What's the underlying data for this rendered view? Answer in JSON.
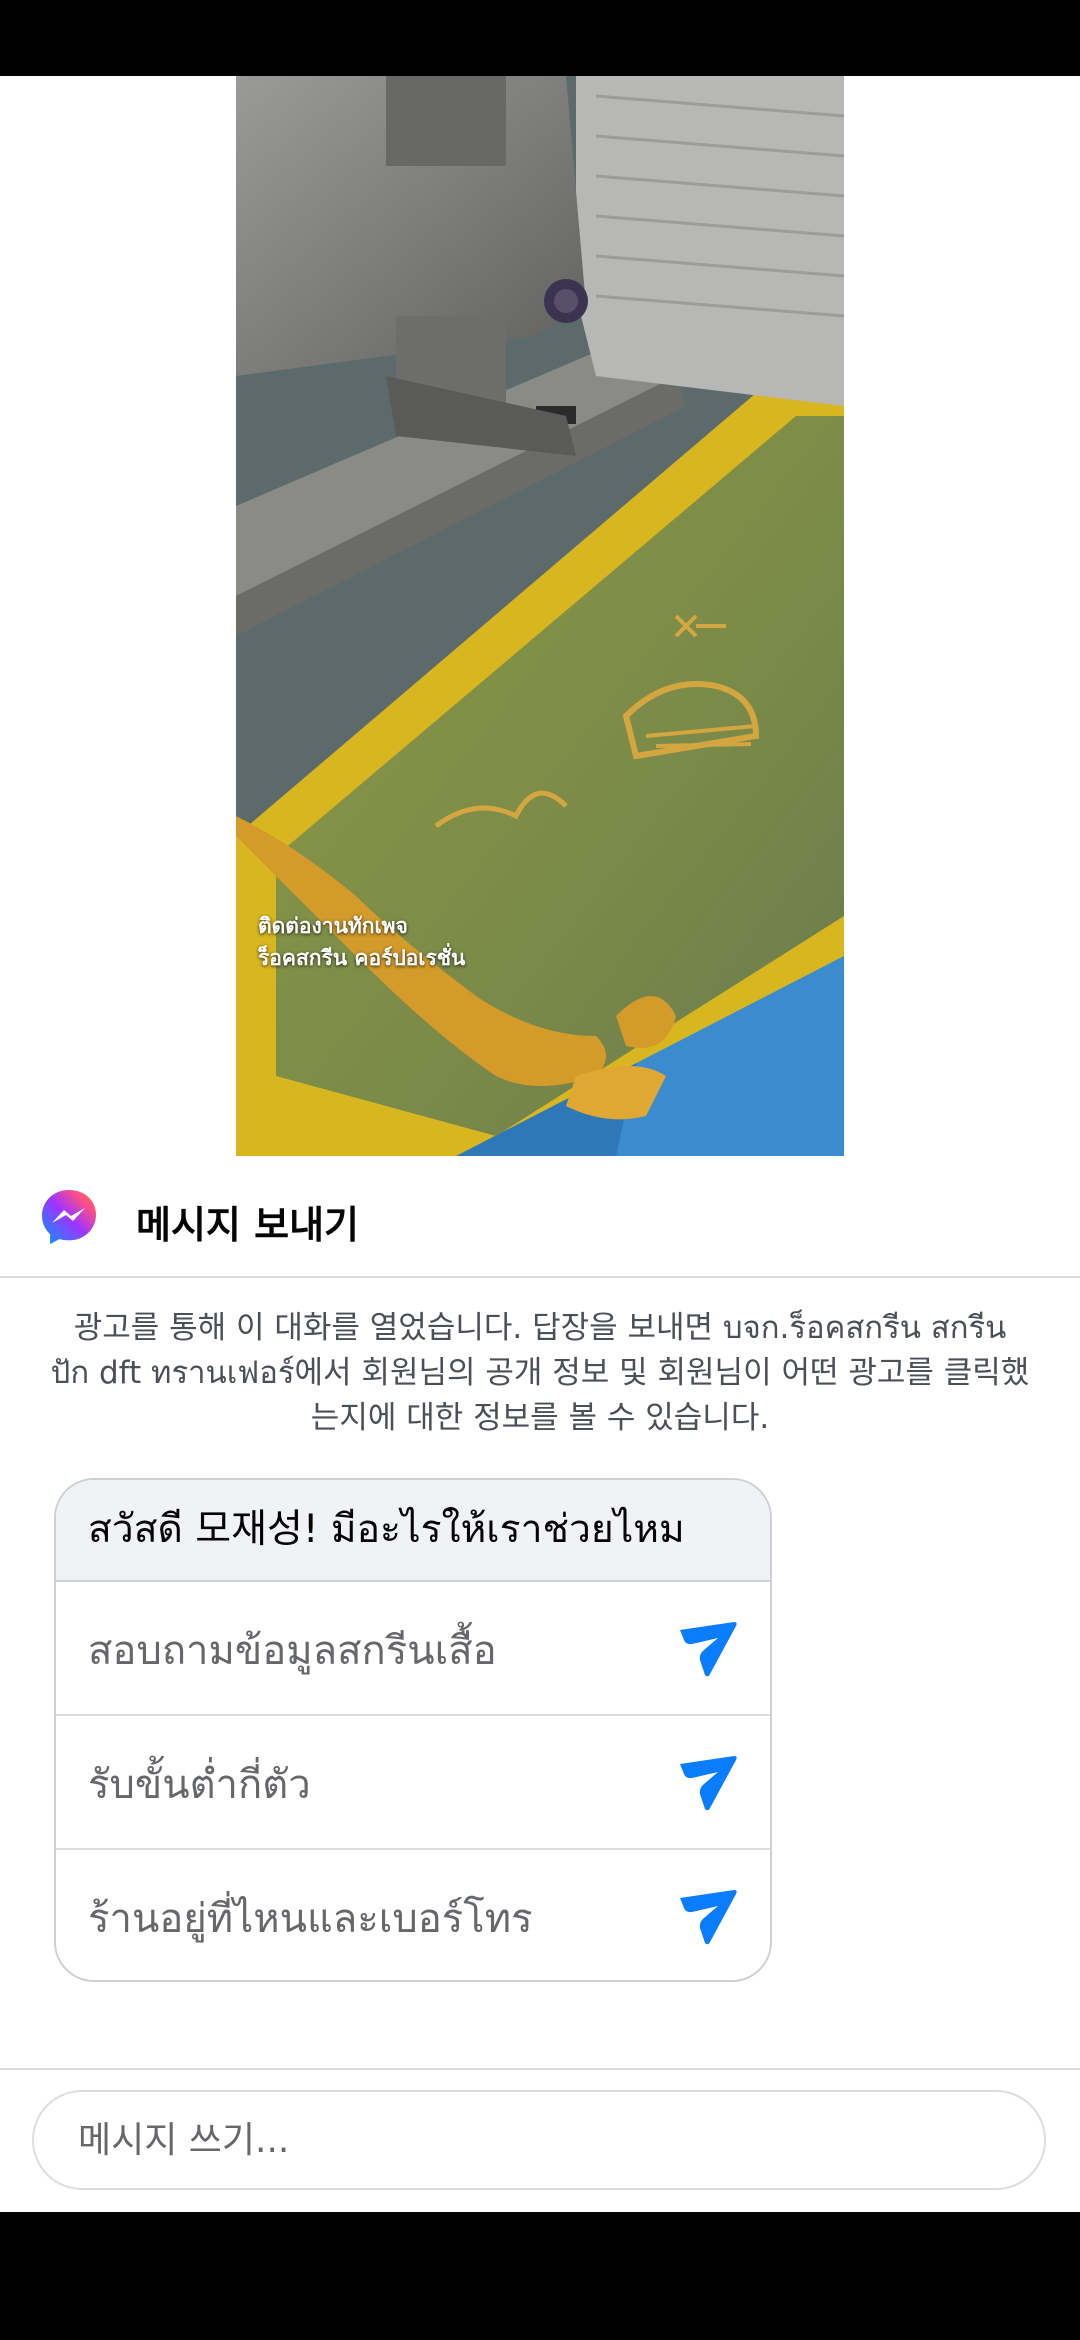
{
  "video": {
    "caption_line1": "ติดต่องานทักเพจ",
    "caption_line2": "ร็อคสกรีน คอร์ปอเรชั่น"
  },
  "header": {
    "icon": "messenger-icon",
    "title": "메시지 보내기"
  },
  "notice": {
    "text": "광고를 통해 이 대화를 열었습니다. 답장을 보내면 บจก.ร็อคสกรีน สกรีน ปัก dft ทรานเฟอร์에서 회원님의 공개 정보 및 회원님이 어떤 광고를 클릭했는지에 대한 정보를 볼 수 있습니다."
  },
  "quick_replies": {
    "greeting": "สวัสดี 모재성! มีอะไรให้เราช่วยไหม",
    "options": [
      {
        "label": "สอบถามข้อมูลสกรีนเสื้อ",
        "icon": "send-icon"
      },
      {
        "label": "รับขั้นต่ำกี่ตัว",
        "icon": "send-icon"
      },
      {
        "label": "ร้านอยู่ที่ไหนและเบอร์โทร",
        "icon": "send-icon"
      }
    ]
  },
  "composer": {
    "placeholder": "메시지 쓰기..."
  },
  "colors": {
    "accent": "#0a7cff",
    "card_header_bg": "#f0f2f5",
    "border": "#ccd0d5"
  }
}
